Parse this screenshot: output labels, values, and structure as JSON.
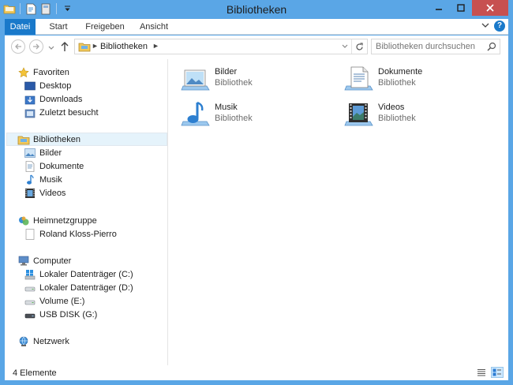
{
  "window": {
    "title": "Bibliotheken",
    "accent_color": "#5aa6e6",
    "close_color": "#c75050"
  },
  "ribbon": {
    "tabs": [
      {
        "label": "Datei"
      },
      {
        "label": "Start"
      },
      {
        "label": "Freigeben"
      },
      {
        "label": "Ansicht"
      }
    ],
    "help_label": "?"
  },
  "address": {
    "crumb": "Bibliotheken",
    "search_placeholder": "Bibliotheken durchsuchen"
  },
  "nav": {
    "favorites": {
      "label": "Favoriten",
      "items": [
        {
          "label": "Desktop"
        },
        {
          "label": "Downloads"
        },
        {
          "label": "Zuletzt besucht"
        }
      ]
    },
    "libraries": {
      "label": "Bibliotheken",
      "items": [
        {
          "label": "Bilder"
        },
        {
          "label": "Dokumente"
        },
        {
          "label": "Musik"
        },
        {
          "label": "Videos"
        }
      ]
    },
    "homegroup": {
      "label": "Heimnetzgruppe",
      "items": [
        {
          "label": "Roland Kloss-Pierro"
        }
      ]
    },
    "computer": {
      "label": "Computer",
      "items": [
        {
          "label": "Lokaler Datenträger (C:)"
        },
        {
          "label": "Lokaler Datenträger (D:)"
        },
        {
          "label": "Volume (E:)"
        },
        {
          "label": "USB DISK (G:)"
        }
      ]
    },
    "network": {
      "label": "Netzwerk"
    }
  },
  "main": {
    "tiles": [
      {
        "name": "Bilder",
        "sub": "Bibliothek",
        "icon": "pictures-library-icon"
      },
      {
        "name": "Dokumente",
        "sub": "Bibliothek",
        "icon": "documents-library-icon"
      },
      {
        "name": "Musik",
        "sub": "Bibliothek",
        "icon": "music-library-icon"
      },
      {
        "name": "Videos",
        "sub": "Bibliothek",
        "icon": "videos-library-icon"
      }
    ]
  },
  "status": {
    "count": "4 Elemente"
  }
}
